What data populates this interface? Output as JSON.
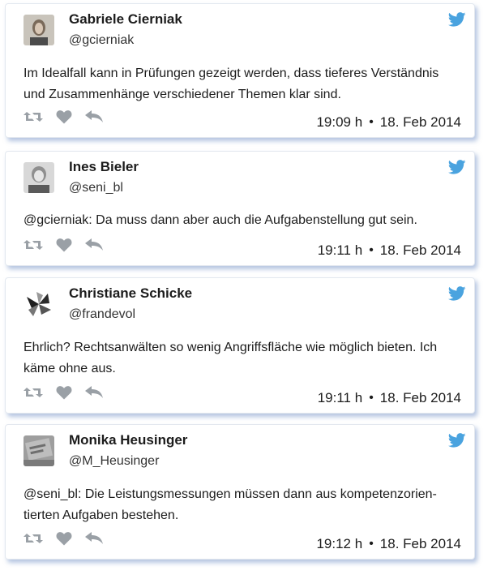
{
  "colors": {
    "twitter_blue": "#4aa3df",
    "action_gray": "#9aa0a6"
  },
  "tweets": [
    {
      "name": "Gabriele Cierniak",
      "handle": "@gcierniak",
      "text": "Im Idealfall kann in Prüfungen gezeigt werden, dass tieferes Verständnis und Zusammenhänge verschiedener Themen klar sind.",
      "time": "19:09 h",
      "separator": "•",
      "date": "18. Feb 2014"
    },
    {
      "name": "Ines Bieler",
      "handle": "@seni_bl",
      "text": "@gcierniak: Da muss dann aber auch die Aufgabenstellung gut sein.",
      "time": "19:11 h",
      "separator": "•",
      "date": "18. Feb 2014"
    },
    {
      "name": "Christiane Schicke",
      "handle": "@frandevol",
      "text": "Ehrlich? Rechtsanwälten so wenig Angriffsfläche wie möglich bieten. Ich käme ohne aus.",
      "time": "19:11 h",
      "separator": "•",
      "date": "18. Feb 2014"
    },
    {
      "name": "Monika Heusinger",
      "handle": "@M_Heusinger",
      "text": "@seni_bl: Die Leistungsmessungen müssen dann aus kompetenzorien-tierten Aufgaben bestehen.",
      "time": "19:12 h",
      "separator": "•",
      "date": "18. Feb 2014"
    }
  ]
}
